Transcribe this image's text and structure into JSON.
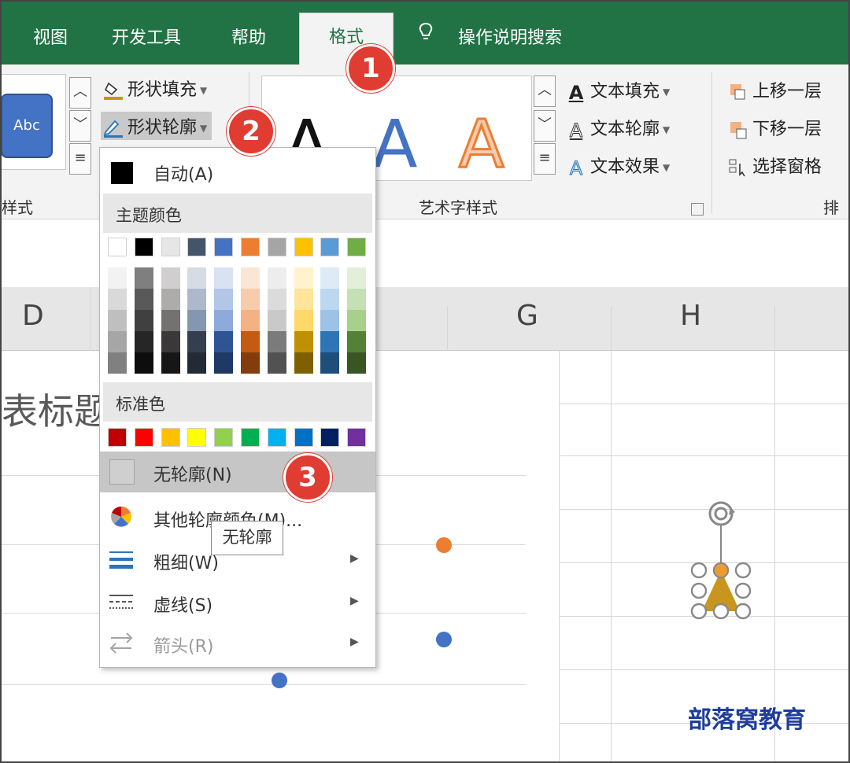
{
  "ribbon_tabs": [
    {
      "label": "视图"
    },
    {
      "label": "开发工具"
    },
    {
      "label": "帮助"
    },
    {
      "label": "格式",
      "active": true
    },
    {
      "label": "操作说明搜索"
    }
  ],
  "shape_styles": {
    "sample_label": "Abc",
    "fill_label": "形状填充",
    "outline_label": "形状轮廓",
    "group_label": "样式"
  },
  "wordart": {
    "sample_glyph": "A",
    "text_fill_label": "文本填充",
    "text_outline_label": "文本轮廓",
    "text_effect_label": "文本效果",
    "group_label": "艺术字样式"
  },
  "arrange": {
    "bring_forward_label": "上移一层",
    "send_backward_label": "下移一层",
    "selection_pane_label": "选择窗格",
    "group_label_partial": "排"
  },
  "outline_menu": {
    "auto_label": "自动(A)",
    "theme_colors_heading": "主题颜色",
    "theme_colors": [
      "#ffffff",
      "#000000",
      "#e7e6e6",
      "#44546a",
      "#4472c4",
      "#ed7d31",
      "#a5a5a5",
      "#ffc000",
      "#5b9bd5",
      "#70ad47"
    ],
    "theme_shades": [
      [
        "#f2f2f2",
        "#d9d9d9",
        "#bfbfbf",
        "#a6a6a6",
        "#808080"
      ],
      [
        "#7f7f7f",
        "#595959",
        "#404040",
        "#262626",
        "#0d0d0d"
      ],
      [
        "#d0cece",
        "#aeabab",
        "#757171",
        "#3a3838",
        "#171616"
      ],
      [
        "#d6dce4",
        "#adb9ca",
        "#8497b0",
        "#333f4f",
        "#222a35"
      ],
      [
        "#d9e2f3",
        "#b4c6e7",
        "#8eaadb",
        "#2f5496",
        "#1f3864"
      ],
      [
        "#fbe5d5",
        "#f7cbac",
        "#f4b183",
        "#c55a11",
        "#833c0b"
      ],
      [
        "#ededed",
        "#dbdbdb",
        "#c9c9c9",
        "#7b7b7b",
        "#525252"
      ],
      [
        "#fff2cc",
        "#fee599",
        "#ffd965",
        "#bf9000",
        "#7f6000"
      ],
      [
        "#deebf6",
        "#bdd7ee",
        "#9cc3e5",
        "#2e75b5",
        "#1e4e79"
      ],
      [
        "#e2efd9",
        "#c5e0b3",
        "#a8d08d",
        "#538135",
        "#375623"
      ]
    ],
    "standard_colors_heading": "标准色",
    "standard_colors": [
      "#c00000",
      "#ff0000",
      "#ffc000",
      "#ffff00",
      "#92d050",
      "#00b050",
      "#00b0f0",
      "#0070c0",
      "#002060",
      "#7030a0"
    ],
    "no_outline_label": "无轮廓(N)",
    "more_colors_label": "其他轮廓颜色(M)...",
    "weight_label": "粗细(W)",
    "dashes_label": "虚线(S)",
    "arrows_label": "箭头(R)",
    "tooltip": "无轮廓"
  },
  "sheet": {
    "columns": [
      "D",
      "G",
      "H"
    ],
    "chart_title_partial": "表标题"
  },
  "step_badges": [
    "1",
    "2",
    "3"
  ],
  "watermark": "部落窝教育",
  "colors": {
    "ribbon_green": "#217346",
    "badge_red": "#e03c32",
    "selected_shape": "#c8961e",
    "dot_orange": "#ed7d31",
    "dot_blue": "#4472c4"
  }
}
